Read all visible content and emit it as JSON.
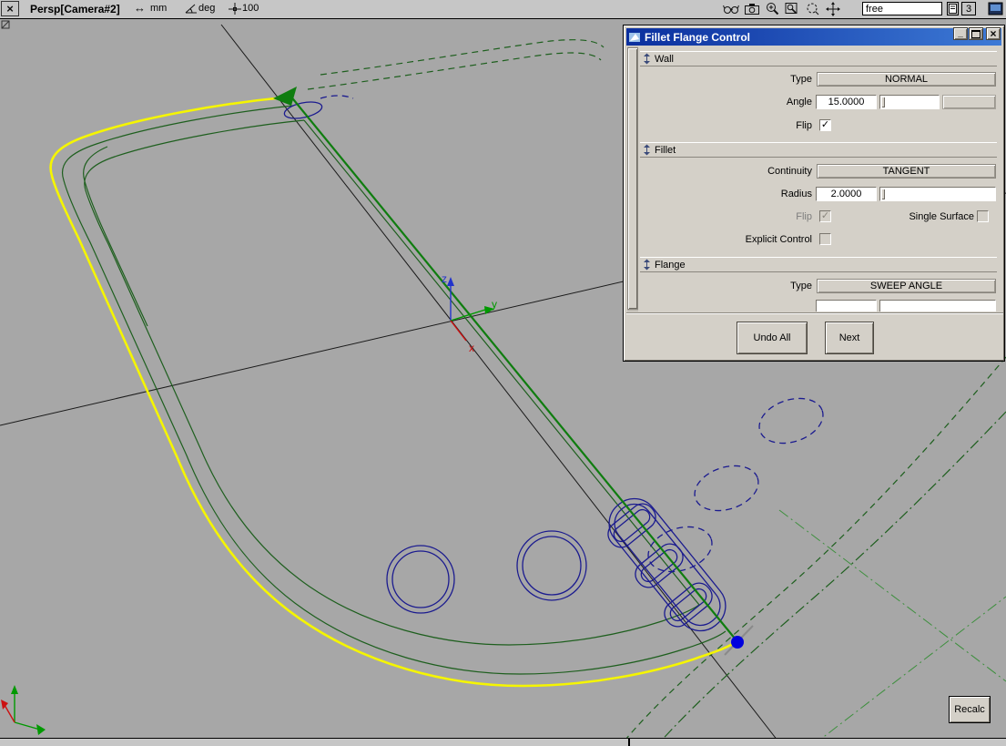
{
  "colors": {
    "toolbar-bg": "#c6c6c6",
    "viewport-bg": "#a7a7a7",
    "dialog-bg": "#d4d0c8",
    "title-grad-a": "#0b2f9e",
    "title-grad-b": "#3d7ad6",
    "curve-green": "#1e5f1e",
    "curve-green-bold": "#0f7d0f",
    "curve-green-light": "#3d8f3d",
    "curve-navy": "#1b1b8f",
    "curve-yellow": "#f5f500",
    "axis-red": "#cc1111",
    "axis-green": "#009900",
    "axis-blue": "#2233cc",
    "ink": "#1a1a1a",
    "endpoint-blue": "#0000dd"
  },
  "toolbar": {
    "camera_label": "Persp[Camera#2]",
    "units_value": "mm",
    "angle_units": "deg",
    "grid_value": "100",
    "free_field_value": "free",
    "pages_button": "3"
  },
  "viewport": {
    "recalc_label": "Recalc",
    "axes": {
      "x": "x",
      "y": "y",
      "z": "z"
    }
  },
  "dialog": {
    "title": "Fillet Flange Control",
    "wall_section": "Wall",
    "wall_type_label": "Type",
    "wall_type_value": "NORMAL",
    "wall_angle_label": "Angle",
    "wall_angle_value": "15.0000",
    "wall_flip_label": "Flip",
    "fillet_section": "Fillet",
    "continuity_label": "Continuity",
    "continuity_value": "TANGENT",
    "radius_label": "Radius",
    "radius_value": "2.0000",
    "fillet_flip_label": "Flip",
    "single_surface_label": "Single Surface",
    "explicit_label": "Explicit Control",
    "flange_section": "Flange",
    "flange_type_label": "Type",
    "flange_type_value": "SWEEP ANGLE",
    "undo_all_label": "Undo All",
    "next_label": "Next",
    "check_glyph": "✓"
  },
  "icons": {
    "viewport_close": "×",
    "units_arrows": "↔",
    "dialog_minimize": "_",
    "dialog_close": "×"
  }
}
